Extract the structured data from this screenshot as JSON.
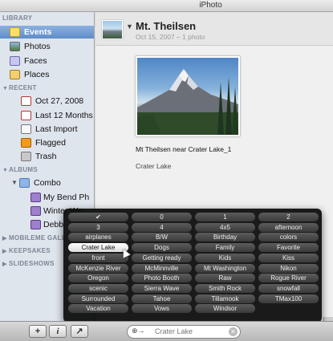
{
  "app": {
    "title": "iPhoto"
  },
  "sidebar": {
    "library_header": "LIBRARY",
    "library": [
      {
        "label": "Events",
        "selected": true,
        "icon": "events-icon"
      },
      {
        "label": "Photos",
        "icon": "photos-icon"
      },
      {
        "label": "Faces",
        "icon": "faces-icon"
      },
      {
        "label": "Places",
        "icon": "places-icon"
      }
    ],
    "recent_header": "RECENT",
    "recent": [
      {
        "label": "Oct 27, 2008",
        "icon": "calendar-icon"
      },
      {
        "label": "Last 12 Months",
        "icon": "calendar-icon"
      },
      {
        "label": "Last Import",
        "icon": "import-icon"
      },
      {
        "label": "Flagged",
        "icon": "flag-icon"
      },
      {
        "label": "Trash",
        "icon": "trash-icon"
      }
    ],
    "albums_header": "ALBUMS",
    "albums_folder": "Combo",
    "albums": [
      {
        "label": "My Bend Ph",
        "icon": "album-icon"
      },
      {
        "label": "Winter Wo",
        "icon": "album-icon"
      },
      {
        "label": "Debb",
        "icon": "album-icon"
      }
    ],
    "mobileme_header": "MOBILEME GALL",
    "keepsakes_header": "KEEPSAKES",
    "slideshows_header": "SLIDESHOWS"
  },
  "event": {
    "title": "Mt. Theilsen",
    "subtitle": "Oct 15, 2007 – 1 photo"
  },
  "photo": {
    "caption": "Mt Theilsen near Crater Lake_1",
    "place": "Crater Lake"
  },
  "keywords": {
    "rows": [
      [
        "✔",
        "0",
        "1",
        "2"
      ],
      [
        "3",
        "4",
        "4x5",
        "afternoon"
      ],
      [
        "airplanes",
        "B/W",
        "Birthday",
        "colors"
      ],
      [
        "Crater Lake",
        "Dogs",
        "Family",
        "Favorite"
      ],
      [
        "front",
        "Getting ready",
        "Kids",
        "Kiss"
      ],
      [
        "McKenzie River",
        "McMinnville",
        "Mt Washington",
        "Nikon"
      ],
      [
        "Oregon",
        "Photo Booth",
        "Raw",
        "Rogue River"
      ],
      [
        "scenic",
        "Sierra Wave",
        "Smith Rock",
        "snowfall"
      ],
      [
        "Surrounded",
        "Tahoe",
        "Tillamook",
        "TMax100"
      ],
      [
        "Vacation",
        "Vows",
        "Windsor",
        ""
      ]
    ],
    "selected": "Crater Lake"
  },
  "toolbar": {
    "add_label": "+",
    "info_label": "i",
    "fullscreen_label": "↗",
    "search_key": "⊕→",
    "search_value": "Crater Lake",
    "clear_label": "✕"
  }
}
